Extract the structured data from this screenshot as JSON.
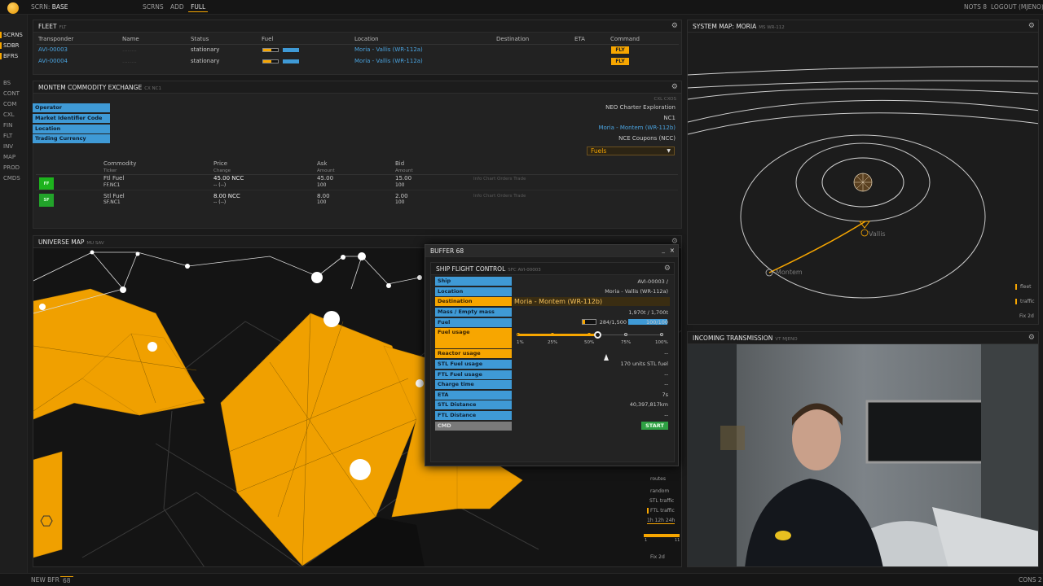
{
  "topbar": {
    "screen_label": "SCRN:",
    "screen_name": "BASE",
    "buttons": [
      "SCRNS",
      "ADD",
      "FULL"
    ],
    "notifications": "NOTS 8",
    "logout": "LOGOUT (MJENO)"
  },
  "sidebar": {
    "items": [
      "SCRNS",
      "SDBR",
      "BFRS",
      "BS",
      "CONT",
      "COM",
      "CXL",
      "FIN",
      "FLT",
      "INV",
      "MAP",
      "PROD",
      "CMDS"
    ]
  },
  "bottombar": {
    "new_buffer": "NEW BFR",
    "buffer_count": "68",
    "cons": "CONS 2"
  },
  "fleet": {
    "title": "FLEET",
    "sub": "FLT",
    "columns": [
      "Transponder",
      "Name",
      "Status",
      "Fuel",
      "Location",
      "Destination",
      "ETA",
      "Command"
    ],
    "rows": [
      {
        "transponder": "AVI-00003",
        "status": "stationary",
        "location": "Moria - Vallis (WR-112a)",
        "command": "FLY",
        "fuel_stl": 0.55,
        "fuel_ftl": 1.0
      },
      {
        "transponder": "AVI-00004",
        "status": "stationary",
        "location": "Moria - Vallis (WR-112a)",
        "command": "FLY",
        "fuel_stl": 0.55,
        "fuel_ftl": 1.0
      }
    ]
  },
  "exchange": {
    "title": "MONTEM COMMODITY EXCHANGE",
    "sub": "CX NC1",
    "code": "CXL",
    "code2": "CXOS",
    "labels": [
      "Operator",
      "Market Identifier Code",
      "Location",
      "Trading Currency"
    ],
    "values": [
      "NEO Charter Exploration",
      "NC1",
      "Moria - Montem (WR-112b)",
      "NCE Coupons (NCC)"
    ],
    "filter": "Fuels",
    "columns": [
      {
        "main": "Commodity",
        "sub": "Ticker"
      },
      {
        "main": "Price",
        "sub": "Change"
      },
      {
        "main": "Ask",
        "sub": "Amount"
      },
      {
        "main": "Bid",
        "sub": "Amount"
      }
    ],
    "rows": [
      {
        "chip": "FF",
        "name": "Ftl Fuel",
        "ticker": "FF.NC1",
        "price": "45.00 NCC",
        "change": "-- (--)",
        "ask": "45.00",
        "ask_amt": "100",
        "bid": "15.00",
        "bid_amt": "100",
        "actions": "Info Chart Orders Trade"
      },
      {
        "chip": "SF",
        "name": "Stl Fuel",
        "ticker": "SF.NC1",
        "price": "8.00 NCC",
        "change": "-- (--)",
        "ask": "8.00",
        "ask_amt": "100",
        "bid": "2.00",
        "bid_amt": "100",
        "actions": "Info Chart Orders Trade"
      }
    ]
  },
  "universe_map": {
    "title": "UNIVERSE MAP",
    "sub": "MU SAV",
    "controls": [
      "routes",
      "random",
      "STL traffic",
      "FTL traffic"
    ],
    "times": "1h 12h 24h",
    "scale_min": "1",
    "scale_max": "11",
    "fix": "Fix 2d"
  },
  "buffer": {
    "title": "BUFFER 68",
    "ship_flight": {
      "title": "SHIP FLIGHT CONTROL",
      "sub": "SFC AVI-00003",
      "labels": [
        "Ship",
        "Location",
        "Destination",
        "Mass / Empty mass",
        "Fuel",
        "Fuel usage",
        "Reactor usage",
        "STL Fuel usage",
        "FTL Fuel usage",
        "Charge time",
        "ETA",
        "STL Distance",
        "FTL Distance",
        "CMD"
      ],
      "ship": "AVI-00003 /",
      "location": "Moria - Vallis (WR-112a)",
      "destination": "Moria - Montem (WR-112b)",
      "mass": "1,970t / 1,700t",
      "fuel_stl": "284/1,500",
      "fuel_ftl": "100/100",
      "fuel_stl_fill": 0.19,
      "fuel_ftl_fill": 1.0,
      "fuel_usage_ticks": [
        "1%",
        "25%",
        "50%",
        "75%",
        "100%"
      ],
      "fuel_usage_selected": 0.55,
      "reactor": "--",
      "stl_fuel": "170 units STL fuel",
      "ftl_fuel": "--",
      "charge": "--",
      "eta": "7s",
      "stl_distance": "40,397,817km",
      "ftl_distance": "--",
      "start": "START"
    }
  },
  "system_map": {
    "title": "SYSTEM MAP: MORIA",
    "sub": "MS WR-112",
    "planet1": "Vallis",
    "planet2": "Montem",
    "legend": [
      "fleet",
      "traffic",
      "Fix 2d"
    ]
  },
  "transmission": {
    "title": "INCOMING TRANSMISSION",
    "sub": "VT MJENO"
  },
  "colors": {
    "accent": "#f7a600",
    "blue": "#3f9ad6",
    "panel": "#222222"
  }
}
